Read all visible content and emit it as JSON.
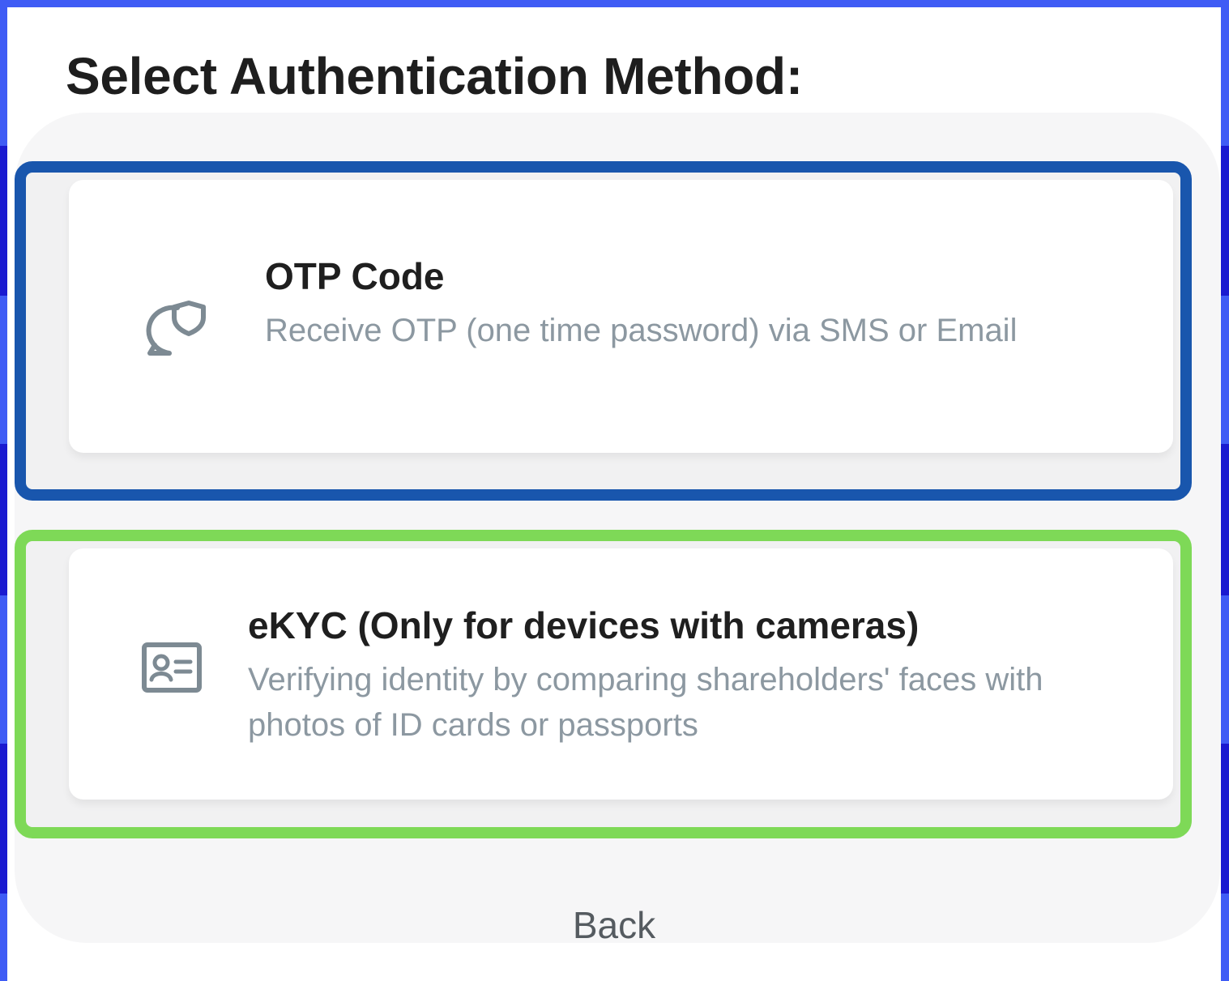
{
  "page": {
    "title": "Select Authentication Method:"
  },
  "options": [
    {
      "title": "OTP Code",
      "description": "Receive OTP (one time password) via SMS or Email",
      "icon": "chat-shield-icon"
    },
    {
      "title": "eKYC (Only for devices with cameras)",
      "description": "Verifying identity by comparing shareholders' faces with photos of ID cards or passports",
      "icon": "id-card-icon"
    }
  ],
  "back_label": "Back",
  "colors": {
    "otp_highlight": "#1956ad",
    "ekyc_highlight": "#7ed957",
    "description_text": "#8c98a1"
  }
}
